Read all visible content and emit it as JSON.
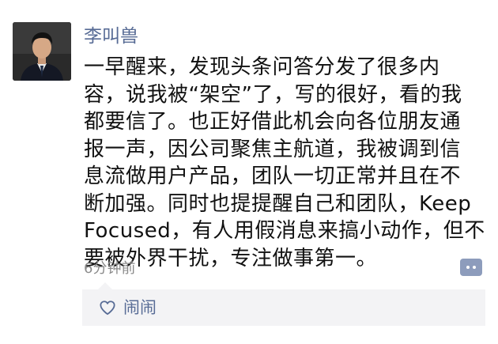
{
  "post": {
    "author": "李叫兽",
    "content": "一早醒来，发现头条问答分发了很多内\n容，说我被“架空”了，写的很好，看的我\n都要信了。也正好借此机会向各位朋友通\n报一声，因公司聚焦主航道，我被调到信\n息流做用户产品，团队一切正常并且在不\n断加强。同时也提提醒自己和团队，Keep\nFocused，有人用假消息来搞小动作，但不\n要被外界干扰，专注做事第一。",
    "timestamp": "6分钟前"
  },
  "likes": {
    "names": "闹闹"
  },
  "icons": {
    "comment": "comment-dots-icon",
    "like": "heart-outline-icon"
  },
  "colors": {
    "name_link": "#576b95",
    "comment_button": "#8d9cbc",
    "like_box_bg": "#f3f3f5"
  }
}
